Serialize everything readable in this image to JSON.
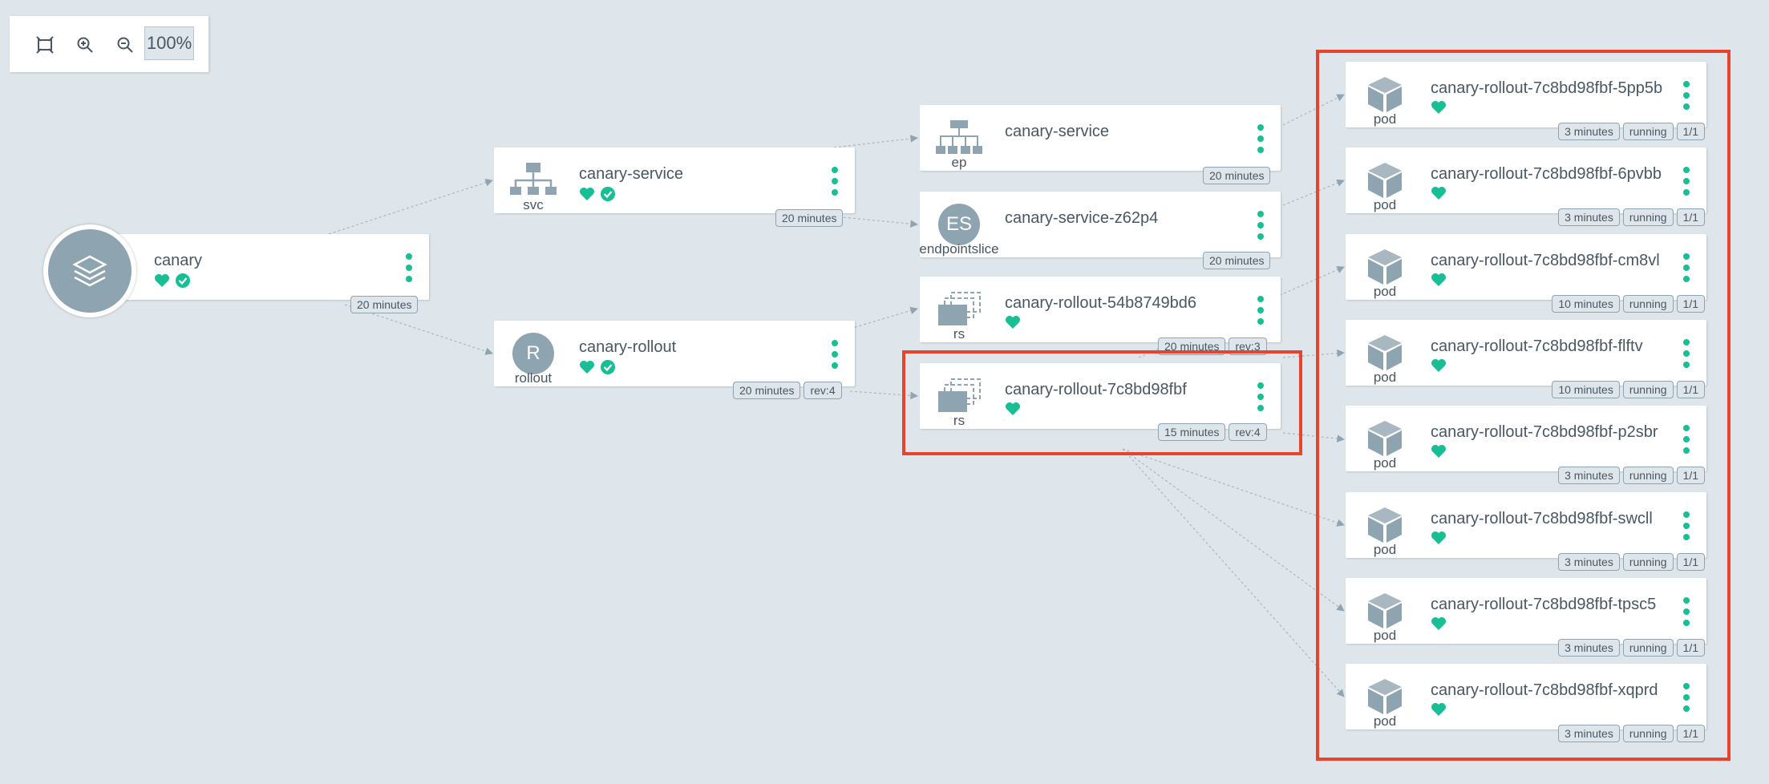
{
  "toolbar": {
    "icons": [
      "fit-screen-icon",
      "zoom-in-icon",
      "zoom-out-icon"
    ],
    "zoom_level": "100%"
  },
  "colors": {
    "healthy": "#18be94",
    "synced": "#18be94",
    "highlight": "#e8432d",
    "icon": "#8fa4b1"
  },
  "app": {
    "name": "canary",
    "age": "20 minutes",
    "health": "heart-icon",
    "sync": "check-circle-icon"
  },
  "svc": {
    "kind": "svc",
    "name": "canary-service",
    "age": "20 minutes"
  },
  "rollout": {
    "kind": "rollout",
    "letter": "R",
    "name": "canary-rollout",
    "age": "20 minutes",
    "rev": "rev:4"
  },
  "ep": {
    "kind": "ep",
    "name": "canary-service",
    "age": "20 minutes"
  },
  "endpointslice": {
    "kind": "endpointslice",
    "letter": "ES",
    "name": "canary-service-z62p4",
    "age": "20 minutes"
  },
  "rs1": {
    "kind": "rs",
    "name": "canary-rollout-54b8749bd6",
    "age": "20 minutes",
    "rev": "rev:3"
  },
  "rs2": {
    "kind": "rs",
    "name": "canary-rollout-7c8bd98fbf",
    "age": "15 minutes",
    "rev": "rev:4"
  },
  "pods": [
    {
      "kind": "pod",
      "name": "canary-rollout-7c8bd98fbf-5pp5b",
      "age": "3 minutes",
      "state": "running",
      "ready": "1/1"
    },
    {
      "kind": "pod",
      "name": "canary-rollout-7c8bd98fbf-6pvbb",
      "age": "3 minutes",
      "state": "running",
      "ready": "1/1"
    },
    {
      "kind": "pod",
      "name": "canary-rollout-7c8bd98fbf-cm8vl",
      "age": "10 minutes",
      "state": "running",
      "ready": "1/1"
    },
    {
      "kind": "pod",
      "name": "canary-rollout-7c8bd98fbf-flftv",
      "age": "10 minutes",
      "state": "running",
      "ready": "1/1"
    },
    {
      "kind": "pod",
      "name": "canary-rollout-7c8bd98fbf-p2sbr",
      "age": "3 minutes",
      "state": "running",
      "ready": "1/1"
    },
    {
      "kind": "pod",
      "name": "canary-rollout-7c8bd98fbf-swcll",
      "age": "3 minutes",
      "state": "running",
      "ready": "1/1"
    },
    {
      "kind": "pod",
      "name": "canary-rollout-7c8bd98fbf-tpsc5",
      "age": "3 minutes",
      "state": "running",
      "ready": "1/1"
    },
    {
      "kind": "pod",
      "name": "canary-rollout-7c8bd98fbf-xqprd",
      "age": "3 minutes",
      "state": "running",
      "ready": "1/1"
    }
  ]
}
